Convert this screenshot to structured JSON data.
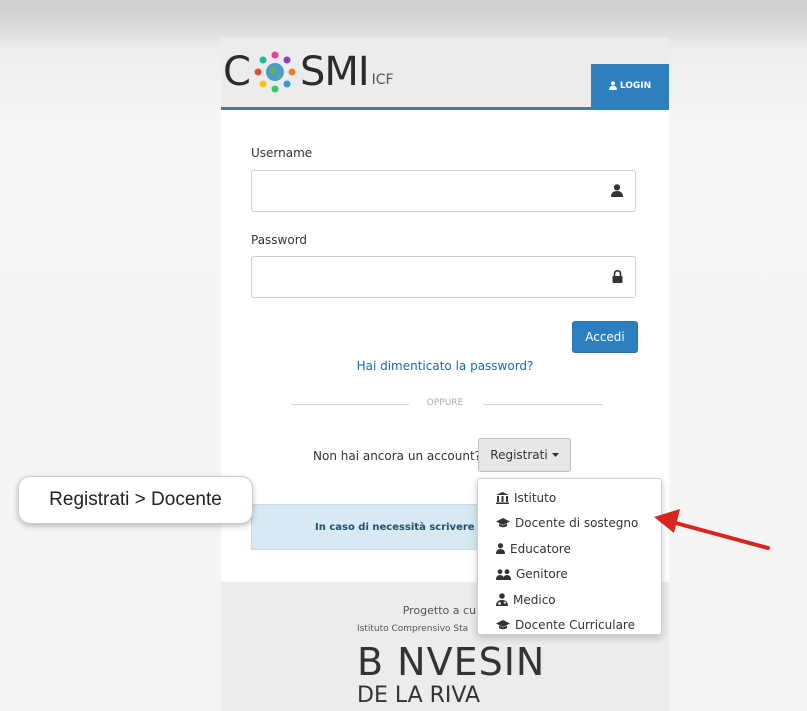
{
  "brand": {
    "logo_c": "C",
    "logo_smi": "SMI",
    "logo_suffix": "ICF",
    "accent_color": "#2e7fbf"
  },
  "header": {
    "login_tab_label": "LOGIN",
    "login_tab_icon": "user-icon"
  },
  "form": {
    "username_label": "Username",
    "username_value": "",
    "username_icon": "user-icon",
    "password_label": "Password",
    "password_value": "",
    "password_icon": "lock-icon",
    "submit_label": "Accedi",
    "forgot_link": "Hai dimenticato la password?",
    "divider_text": "OPPURE",
    "no_account_text": "Non hai ancora un account?",
    "register_button": "Registrati"
  },
  "register_menu": {
    "items": [
      {
        "label": "Istituto",
        "icon": "bank-icon"
      },
      {
        "label": "Docente di sostegno",
        "icon": "graduation-cap-icon"
      },
      {
        "label": "Educatore",
        "icon": "user-icon"
      },
      {
        "label": "Genitore",
        "icon": "users-icon"
      },
      {
        "label": "Medico",
        "icon": "user-md-icon"
      },
      {
        "label": "Docente Curriculare",
        "icon": "graduation-cap-icon"
      }
    ]
  },
  "info_box": {
    "text": "In caso di necessità scrivere a"
  },
  "footer": {
    "project_text": "Progetto a cura",
    "school_text": "Istituto Comprensivo Sta",
    "school_logo_main": "B NVESIN",
    "school_logo_sub": "DE LA RIVA"
  },
  "annotation": {
    "callout_text": "Registrati > Docente",
    "arrow_color": "#d7261e"
  }
}
